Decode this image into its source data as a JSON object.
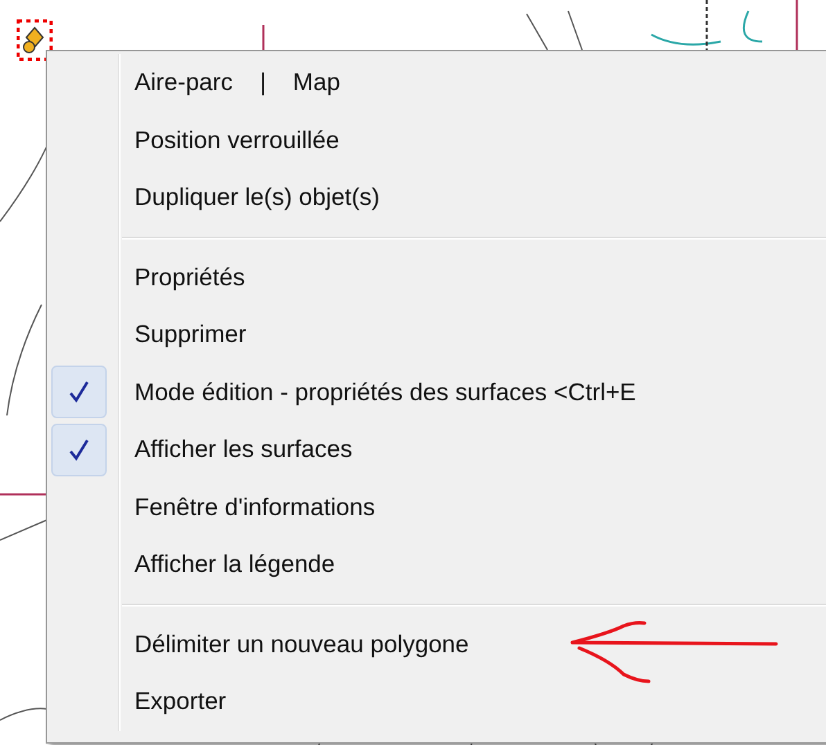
{
  "menu": {
    "items": [
      {
        "kind": "item",
        "label": "Aire-parc    |    Map",
        "checked": false
      },
      {
        "kind": "item",
        "label": "Position verrouillée",
        "checked": false
      },
      {
        "kind": "item",
        "label": "Dupliquer le(s) objet(s)",
        "checked": false
      },
      {
        "kind": "separator"
      },
      {
        "kind": "item",
        "label": "Propriétés",
        "checked": false
      },
      {
        "kind": "item",
        "label": "Supprimer",
        "checked": false
      },
      {
        "kind": "item",
        "label": "Mode édition - propriétés des surfaces <Ctrl+E",
        "checked": true
      },
      {
        "kind": "item",
        "label": "Afficher les surfaces",
        "checked": true
      },
      {
        "kind": "item",
        "label": "Fenêtre d'informations",
        "checked": false
      },
      {
        "kind": "item",
        "label": "Afficher la légende",
        "checked": false
      },
      {
        "kind": "separator"
      },
      {
        "kind": "item",
        "label": "Délimiter un nouveau polygone",
        "checked": false,
        "annotated": true
      },
      {
        "kind": "item",
        "label": "Exporter",
        "checked": false
      }
    ]
  }
}
